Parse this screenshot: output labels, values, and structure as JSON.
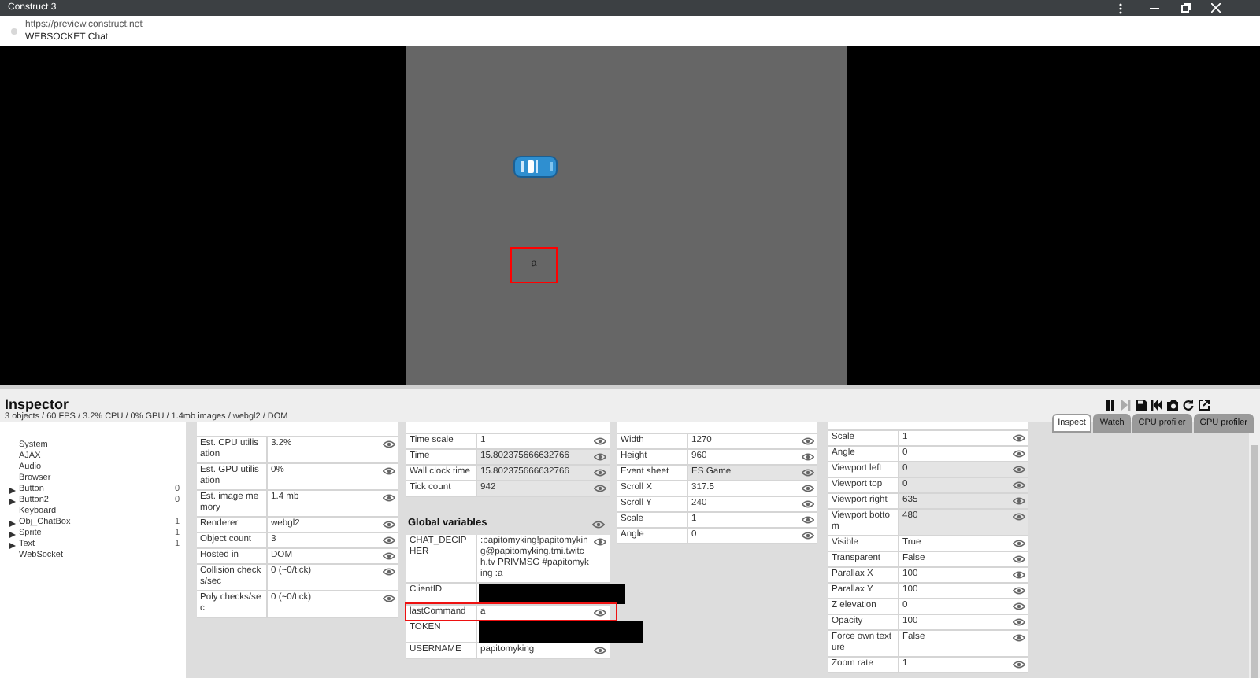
{
  "window": {
    "title": "Construct 3"
  },
  "address_bar": {
    "url": "https://preview.construct.net",
    "page_title": "WEBSOCKET Chat"
  },
  "game": {
    "text_object": {
      "text": "a",
      "selected": true
    }
  },
  "inspector": {
    "title": "Inspector",
    "summary": "3 objects / 60 FPS / 3.2% CPU / 0% GPU / 1.4mb images / webgl2 / DOM",
    "tabs": [
      {
        "label": "Inspect",
        "selected": true
      },
      {
        "label": "Watch",
        "selected": false
      },
      {
        "label": "CPU profiler",
        "selected": false
      },
      {
        "label": "GPU profiler",
        "selected": false
      }
    ],
    "toolbar": [
      {
        "kind": "pause",
        "disabled": false
      },
      {
        "kind": "step",
        "disabled": true
      },
      {
        "kind": "save",
        "disabled": false
      },
      {
        "kind": "load",
        "disabled": false
      },
      {
        "kind": "screenshot",
        "disabled": false
      },
      {
        "kind": "restart",
        "disabled": false
      },
      {
        "kind": "popout",
        "disabled": false
      }
    ],
    "object_tree": [
      {
        "label": "System",
        "expandable": false
      },
      {
        "label": "AJAX",
        "expandable": false
      },
      {
        "label": "Audio",
        "expandable": false
      },
      {
        "label": "Browser",
        "expandable": false
      },
      {
        "label": "Button",
        "expandable": true,
        "count": "0"
      },
      {
        "label": "Button2",
        "expandable": true,
        "count": "0"
      },
      {
        "label": "Keyboard",
        "expandable": false
      },
      {
        "label": "Obj_ChatBox",
        "expandable": true,
        "count": "1"
      },
      {
        "label": "Sprite",
        "expandable": true,
        "count": "1"
      },
      {
        "label": "Text",
        "expandable": true,
        "count": "1"
      },
      {
        "label": "WebSocket",
        "expandable": false
      }
    ],
    "panels": [
      {
        "rows": [
          {
            "label": "Est. CPU utilisation",
            "value": "3.2%",
            "readonly": false
          },
          {
            "label": "Est. GPU utilisation",
            "value": "0%",
            "readonly": false
          },
          {
            "label": "Est. image memory",
            "value": "1.4 mb",
            "readonly": false
          },
          {
            "label": "Renderer",
            "value": "webgl2",
            "readonly": false
          },
          {
            "label": "Object count",
            "value": "3",
            "readonly": false
          },
          {
            "label": "Hosted in",
            "value": "DOM",
            "readonly": false
          },
          {
            "label": "Collision checks/sec",
            "value": "0 (~0/tick)",
            "readonly": false
          },
          {
            "label": "Poly checks/sec",
            "value": "0 (~0/tick)",
            "readonly": false
          }
        ]
      },
      {
        "rows": [
          {
            "label": "Time scale",
            "value": "1",
            "readonly": false
          },
          {
            "label": "Time",
            "value": "15.802375666632766",
            "readonly": true
          },
          {
            "label": "Wall clock time",
            "value": "15.802375666632766",
            "readonly": true
          },
          {
            "label": "Tick count",
            "value": "942",
            "readonly": true
          }
        ],
        "section": {
          "title": "Global variables",
          "rows": [
            {
              "label": "CHAT_DECIPHER",
              "value": ":papitomyking!papitomyking@papitomyking.tmi.twitch.tv PRIVMSG #papitomyking :a",
              "redacted": false,
              "highlighted": false
            },
            {
              "label": "ClientID",
              "redacted": true,
              "highlighted": false
            },
            {
              "label": "lastCommand",
              "value": "a",
              "redacted": false,
              "highlighted": true
            },
            {
              "label": "TOKEN",
              "redacted": true,
              "highlighted": false
            },
            {
              "label": "USERNAME",
              "value": "papitomyking",
              "redacted": false,
              "highlighted": false
            }
          ]
        }
      },
      {
        "rows": [
          {
            "label": "Width",
            "value": "1270",
            "readonly": false
          },
          {
            "label": "Height",
            "value": "960",
            "readonly": false
          },
          {
            "label": "Event sheet",
            "value": "ES Game",
            "readonly": true
          },
          {
            "label": "Scroll X",
            "value": "317.5",
            "readonly": false
          },
          {
            "label": "Scroll Y",
            "value": "240",
            "readonly": false
          },
          {
            "label": "Scale",
            "value": "1",
            "readonly": false
          },
          {
            "label": "Angle",
            "value": "0",
            "readonly": false
          }
        ]
      },
      {
        "rows": [
          {
            "label": "Scale",
            "value": "1",
            "readonly": false
          },
          {
            "label": "Angle",
            "value": "0",
            "readonly": false
          },
          {
            "label": "Viewport left",
            "value": "0",
            "readonly": true
          },
          {
            "label": "Viewport top",
            "value": "0",
            "readonly": true
          },
          {
            "label": "Viewport right",
            "value": "635",
            "readonly": true
          },
          {
            "label": "Viewport bottom",
            "value": "480",
            "readonly": true
          },
          {
            "label": "Visible",
            "value": "True",
            "readonly": false
          },
          {
            "label": "Transparent",
            "value": "False",
            "readonly": false
          },
          {
            "label": "Parallax X",
            "value": "100",
            "readonly": false
          },
          {
            "label": "Parallax Y",
            "value": "100",
            "readonly": false
          },
          {
            "label": "Z elevation",
            "value": "0",
            "readonly": false
          },
          {
            "label": "Opacity",
            "value": "100",
            "readonly": false
          },
          {
            "label": "Force own texture",
            "value": "False",
            "readonly": false
          },
          {
            "label": "Zoom rate",
            "value": "1",
            "readonly": false
          }
        ]
      }
    ]
  }
}
